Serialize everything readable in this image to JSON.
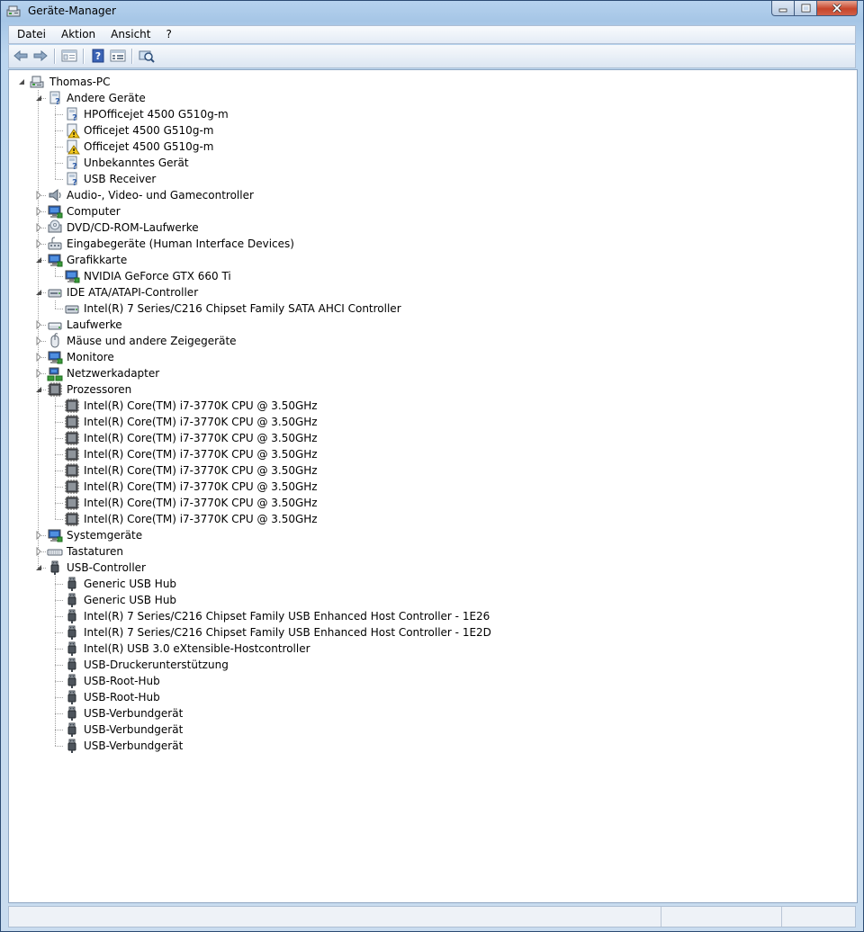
{
  "window": {
    "title": "Geräte-Manager"
  },
  "menu": [
    "Datei",
    "Aktion",
    "Ansicht",
    "?"
  ],
  "toolbar": {
    "buttons": [
      "back-icon",
      "forward-icon",
      "show-hide-console-tree-icon",
      "help-icon",
      "properties-icon",
      "scan-hardware-icon"
    ]
  },
  "tree": {
    "root": "Thomas-PC",
    "rows": [
      {
        "label": "Thomas-PC",
        "level": 0,
        "expander": "open",
        "icon": "computer"
      },
      {
        "label": "Andere Geräte",
        "level": 1,
        "expander": "open",
        "icon": "unknown"
      },
      {
        "label": "HPOfficejet 4500 G510g-m",
        "level": 2,
        "icon": "unknown"
      },
      {
        "label": "Officejet 4500 G510g-m",
        "level": 2,
        "icon": "warning"
      },
      {
        "label": "Officejet 4500 G510g-m",
        "level": 2,
        "icon": "warning"
      },
      {
        "label": "Unbekanntes Gerät",
        "level": 2,
        "icon": "unknown"
      },
      {
        "label": "USB Receiver",
        "level": 2,
        "icon": "unknown"
      },
      {
        "label": "Audio-, Video- und Gamecontroller",
        "level": 1,
        "expander": "closed",
        "icon": "speaker"
      },
      {
        "label": "Computer",
        "level": 1,
        "expander": "closed",
        "icon": "monitor"
      },
      {
        "label": "DVD/CD-ROM-Laufwerke",
        "level": 1,
        "expander": "closed",
        "icon": "dvd"
      },
      {
        "label": "Eingabegeräte (Human Interface Devices)",
        "level": 1,
        "expander": "closed",
        "icon": "hid"
      },
      {
        "label": "Grafikkarte",
        "level": 1,
        "expander": "open",
        "icon": "monitor"
      },
      {
        "label": "NVIDIA GeForce GTX 660 Ti",
        "level": 2,
        "icon": "monitor"
      },
      {
        "label": "IDE ATA/ATAPI-Controller",
        "level": 1,
        "expander": "open",
        "icon": "ide"
      },
      {
        "label": "Intel(R) 7 Series/C216 Chipset Family SATA AHCI Controller",
        "level": 2,
        "icon": "ide"
      },
      {
        "label": "Laufwerke",
        "level": 1,
        "expander": "closed",
        "icon": "drive"
      },
      {
        "label": "Mäuse und andere Zeigegeräte",
        "level": 1,
        "expander": "closed",
        "icon": "mouse"
      },
      {
        "label": "Monitore",
        "level": 1,
        "expander": "closed",
        "icon": "monitor"
      },
      {
        "label": "Netzwerkadapter",
        "level": 1,
        "expander": "closed",
        "icon": "network"
      },
      {
        "label": "Prozessoren",
        "level": 1,
        "expander": "open",
        "icon": "cpu"
      },
      {
        "label": "Intel(R) Core(TM) i7-3770K CPU @ 3.50GHz",
        "level": 2,
        "icon": "cpu"
      },
      {
        "label": "Intel(R) Core(TM) i7-3770K CPU @ 3.50GHz",
        "level": 2,
        "icon": "cpu"
      },
      {
        "label": "Intel(R) Core(TM) i7-3770K CPU @ 3.50GHz",
        "level": 2,
        "icon": "cpu"
      },
      {
        "label": "Intel(R) Core(TM) i7-3770K CPU @ 3.50GHz",
        "level": 2,
        "icon": "cpu"
      },
      {
        "label": "Intel(R) Core(TM) i7-3770K CPU @ 3.50GHz",
        "level": 2,
        "icon": "cpu"
      },
      {
        "label": "Intel(R) Core(TM) i7-3770K CPU @ 3.50GHz",
        "level": 2,
        "icon": "cpu"
      },
      {
        "label": "Intel(R) Core(TM) i7-3770K CPU @ 3.50GHz",
        "level": 2,
        "icon": "cpu"
      },
      {
        "label": "Intel(R) Core(TM) i7-3770K CPU @ 3.50GHz",
        "level": 2,
        "icon": "cpu"
      },
      {
        "label": "Systemgeräte",
        "level": 1,
        "expander": "closed",
        "icon": "monitor"
      },
      {
        "label": "Tastaturen",
        "level": 1,
        "expander": "closed",
        "icon": "keyboard"
      },
      {
        "label": "USB-Controller",
        "level": 1,
        "expander": "open",
        "icon": "usb"
      },
      {
        "label": "Generic USB Hub",
        "level": 2,
        "icon": "usb"
      },
      {
        "label": "Generic USB Hub",
        "level": 2,
        "icon": "usb"
      },
      {
        "label": "Intel(R) 7 Series/C216 Chipset Family USB Enhanced Host Controller - 1E26",
        "level": 2,
        "icon": "usb"
      },
      {
        "label": "Intel(R) 7 Series/C216 Chipset Family USB Enhanced Host Controller - 1E2D",
        "level": 2,
        "icon": "usb"
      },
      {
        "label": "Intel(R) USB 3.0 eXtensible-Hostcontroller",
        "level": 2,
        "icon": "usb"
      },
      {
        "label": "USB-Druckerunterstützung",
        "level": 2,
        "icon": "usb"
      },
      {
        "label": "USB-Root-Hub",
        "level": 2,
        "icon": "usb"
      },
      {
        "label": "USB-Root-Hub",
        "level": 2,
        "icon": "usb"
      },
      {
        "label": "USB-Verbundgerät",
        "level": 2,
        "icon": "usb"
      },
      {
        "label": "USB-Verbundgerät",
        "level": 2,
        "icon": "usb"
      },
      {
        "label": "USB-Verbundgerät",
        "level": 2,
        "icon": "usb"
      }
    ]
  },
  "colors": {
    "titlebar": "#a6c6e6",
    "close": "#c7452a",
    "tree_line": "#a0a0a0"
  }
}
